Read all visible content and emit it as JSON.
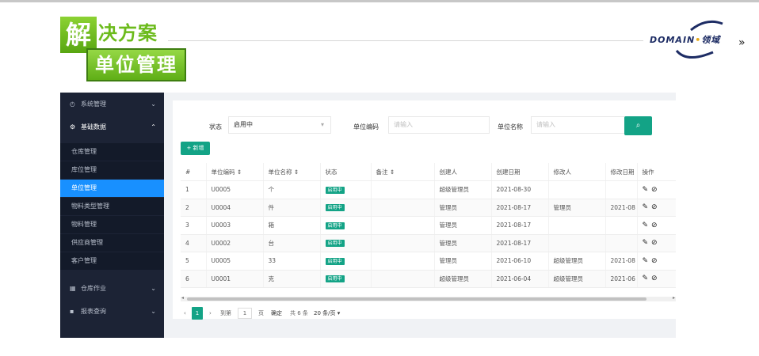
{
  "slide": {
    "title_first_char": "解",
    "title_rest": "决方案",
    "subtitle": "单位管理",
    "logo_text": "DOMAIN",
    "logo_dot": "•",
    "logo_cn": "领域",
    "nav_chevron": "»"
  },
  "sidebar": {
    "items": [
      {
        "label": "系统管理",
        "icon": "gauge-icon",
        "glyph": "◴",
        "arrow": "⌄"
      },
      {
        "label": "基础数据",
        "icon": "gear-icon",
        "glyph": "⚙",
        "arrow": "⌃"
      },
      {
        "label": "仓库管理"
      },
      {
        "label": "库位管理"
      },
      {
        "label": "单位管理"
      },
      {
        "label": "物料类型管理"
      },
      {
        "label": "物料管理"
      },
      {
        "label": "供应商管理"
      },
      {
        "label": "客户管理"
      },
      {
        "label": "仓库作业",
        "icon": "grid-icon",
        "glyph": "▦",
        "arrow": "⌄"
      },
      {
        "label": "报表查询",
        "icon": "chat-icon",
        "glyph": "▪",
        "arrow": "⌄"
      }
    ],
    "active_index": 4
  },
  "filters": {
    "status_label": "状态",
    "status_value": "启用中",
    "code_label": "单位编码",
    "code_placeholder": "请输入",
    "name_label": "单位名称",
    "name_placeholder": "请输入",
    "search_glyph": "⌕"
  },
  "toolbar": {
    "add_label": "+ 新增"
  },
  "table": {
    "columns": [
      "#",
      "单位编码 ⇕",
      "单位名称 ⇕",
      "状态",
      "备注 ⇕",
      "创建人",
      "创建日期",
      "修改人",
      "修改日期",
      "操作"
    ],
    "rows": [
      {
        "no": "1",
        "code": "U0005",
        "name": "个",
        "status": "启用中",
        "remark": "",
        "creator": "超级管理员",
        "created": "2021-08-30",
        "modifier": "",
        "modified": ""
      },
      {
        "no": "2",
        "code": "U0004",
        "name": "件",
        "status": "启用中",
        "remark": "",
        "creator": "管理员",
        "created": "2021-08-17",
        "modifier": "管理员",
        "modified": "2021-08"
      },
      {
        "no": "3",
        "code": "U0003",
        "name": "箱",
        "status": "启用中",
        "remark": "",
        "creator": "管理员",
        "created": "2021-08-17",
        "modifier": "",
        "modified": ""
      },
      {
        "no": "4",
        "code": "U0002",
        "name": "台",
        "status": "启用中",
        "remark": "",
        "creator": "管理员",
        "created": "2021-08-17",
        "modifier": "",
        "modified": ""
      },
      {
        "no": "5",
        "code": "U0005",
        "name": "33",
        "status": "启用中",
        "remark": "",
        "creator": "管理员",
        "created": "2021-06-10",
        "modifier": "超级管理员",
        "modified": "2021-08"
      },
      {
        "no": "6",
        "code": "U0001",
        "name": "克",
        "status": "启用中",
        "remark": "",
        "creator": "超级管理员",
        "created": "2021-06-04",
        "modifier": "超级管理员",
        "modified": "2021-06"
      }
    ],
    "edit_glyph": "✎",
    "disable_glyph": "⊘"
  },
  "pager": {
    "prev": "‹",
    "current": "1",
    "next": "›",
    "goto_label": "到第",
    "goto_value": "1",
    "page_unit": "页",
    "confirm": "确定",
    "total": "共 6 条",
    "page_size": "20 条/页 ▾"
  },
  "colors": {
    "accent": "#13a386",
    "active_nav": "#1890ff",
    "sidebar_bg": "#1c2335",
    "title_green": "#6cbb1c"
  }
}
